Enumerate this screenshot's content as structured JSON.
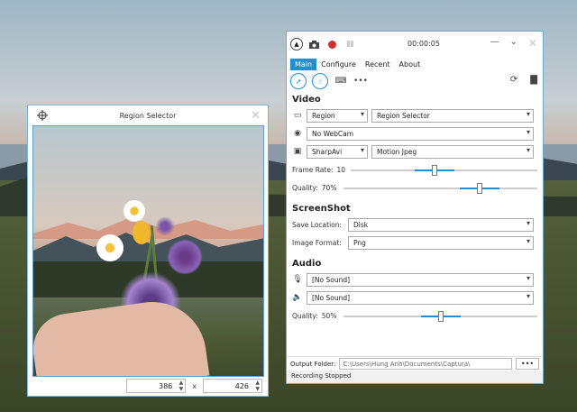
{
  "region_selector": {
    "title": "Region Selector",
    "width_value": "386",
    "times_sign": "x",
    "height_value": "426"
  },
  "captura": {
    "timer": "00:00:05",
    "tabs": [
      {
        "label": "Main",
        "active": true
      },
      {
        "label": "Configure"
      },
      {
        "label": "Recent"
      },
      {
        "label": "About"
      }
    ],
    "video": {
      "heading": "Video",
      "source_type": "Region",
      "source_value": "Region Selector",
      "webcam": "No WebCam",
      "writer": "SharpAvi",
      "codec": "Motion Jpeg",
      "frame_rate_label": "Frame Rate:",
      "frame_rate_value": "10",
      "frame_rate_level": 0.45,
      "quality_label": "Quality:",
      "quality_value": "70%",
      "quality_level": 0.7
    },
    "screenshot": {
      "heading": "ScreenShot",
      "save_location_label": "Save Location:",
      "save_location_value": "Disk",
      "image_format_label": "Image Format:",
      "image_format_value": "Png"
    },
    "audio": {
      "heading": "Audio",
      "microphone": "[No Sound]",
      "speaker": "[No Sound]",
      "quality_label": "Quality:",
      "quality_value": "50%",
      "quality_level": 0.5
    },
    "output_folder_label": "Output Folder:",
    "output_folder_value": "C:\\Users\\Hung Anh\\Documents\\Captura\\",
    "browse_label": "•••",
    "status": "Recording Stopped"
  }
}
